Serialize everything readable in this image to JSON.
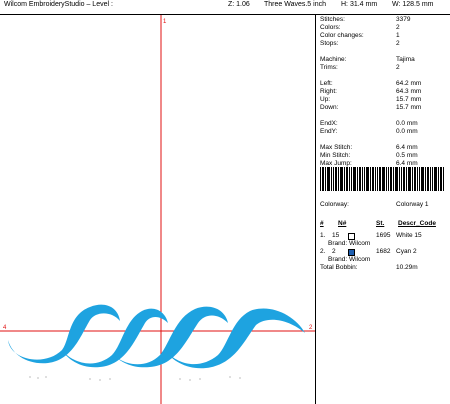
{
  "header": {
    "app_title": "Wilcom EmbroideryStudio – Level :",
    "zoom": "Z: 1.06",
    "design_name": "Three Waves.5 inch",
    "height": "H: 31.4 mm",
    "width": "W: 128.5 mm"
  },
  "canvas": {
    "axis_top_label": "1",
    "axis_left_label": "4",
    "axis_right_label": "2",
    "thread_color": "#1ea3e0",
    "axis_color": "#e01010"
  },
  "stats": [
    {
      "label": "Stitches:",
      "value": "3379"
    },
    {
      "label": "Colors:",
      "value": "2"
    },
    {
      "label": "Color changes:",
      "value": "1"
    },
    {
      "label": "Stops:",
      "value": "2"
    },
    {
      "label": "Machine:",
      "value": "Tajima"
    },
    {
      "label": "Trims:",
      "value": "2"
    },
    {
      "label": "Left:",
      "value": "64.2 mm"
    },
    {
      "label": "Right:",
      "value": "64.3 mm"
    },
    {
      "label": "Up:",
      "value": "15.7 mm"
    },
    {
      "label": "Down:",
      "value": "15.7 mm"
    },
    {
      "label": "EndX:",
      "value": "0.0 mm"
    },
    {
      "label": "EndY:",
      "value": "0.0 mm"
    },
    {
      "label": "Max Stitch:",
      "value": "6.4 mm"
    },
    {
      "label": "Min Stitch:",
      "value": "0.5 mm"
    },
    {
      "label": "Max Jump:",
      "value": "6.4 mm"
    }
  ],
  "colorway": {
    "label": "Colorway:",
    "value": "Colorway 1"
  },
  "table": {
    "headers": {
      "num": "#",
      "n": "N#",
      "sl": "St.",
      "descr": "Descr_Code"
    },
    "rows": [
      {
        "num": "1.",
        "n": "15",
        "swatch": "#ffffff",
        "sl": "1695",
        "descr": "White 15",
        "brand": "Brand: Wilcom"
      },
      {
        "num": "2.",
        "n": "2",
        "swatch": "#1ea3e0",
        "sl": "1682",
        "descr": "Cyan 2",
        "brand": "Brand: Wilcom"
      }
    ],
    "total_label": "Total Bobbin:",
    "total_value": "10.29m"
  }
}
